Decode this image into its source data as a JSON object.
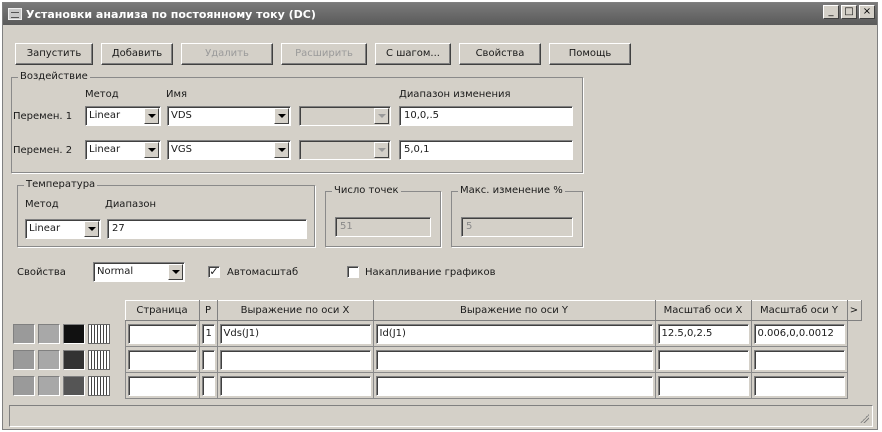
{
  "window": {
    "title": "Установки анализа по постоянному току (DC)",
    "controls": {
      "minimize": "_",
      "maximize": "□",
      "close": "×"
    }
  },
  "toolbar": {
    "run": "Запустить",
    "add": "Добавить",
    "delete": "Удалить",
    "expand": "Расширить",
    "step": "С шагом...",
    "properties": "Свойства",
    "help": "Помощь"
  },
  "sweep": {
    "group_label": "Воздействие",
    "header_method": "Метод",
    "header_name": "Имя",
    "header_range": "Диапазон изменения",
    "rows": [
      {
        "label": "Перемен. 1",
        "method": "Linear",
        "name": "VDS",
        "extra": "",
        "range": "10,0,.5"
      },
      {
        "label": "Перемен. 2",
        "method": "Linear",
        "name": "VGS",
        "extra": "",
        "range": "5,0,1"
      }
    ]
  },
  "temperature": {
    "group_label": "Температура",
    "method_label": "Метод",
    "range_label": "Диапазон",
    "method": "Linear",
    "range": "27"
  },
  "points": {
    "group_label": "Число точек",
    "value": "51"
  },
  "maxchange": {
    "group_label": "Макс. изменение %",
    "value": "5"
  },
  "options": {
    "properties_label": "Свойства",
    "properties_value": "Normal",
    "autoscale_label": "Автомасштаб",
    "autoscale_checked": true,
    "accumulate_label": "Накапливание графиков",
    "accumulate_checked": false
  },
  "grid": {
    "headers": {
      "page": "Страница",
      "p": "P",
      "xexpr": "Выражение по оси X",
      "yexpr": "Выражение по оси Y",
      "xscale": "Масштаб оси X",
      "yscale": "Масштаб оси Y",
      "more": ">"
    },
    "rows": [
      {
        "page": "",
        "p": "1",
        "xexpr": "Vds(J1)",
        "yexpr": "Id(J1)",
        "xscale": "12.5,0,2.5",
        "yscale": "0.006,0,0.0012"
      },
      {
        "page": "",
        "p": "",
        "xexpr": "",
        "yexpr": "",
        "xscale": "",
        "yscale": ""
      },
      {
        "page": "",
        "p": "",
        "xexpr": "",
        "yexpr": "",
        "xscale": "",
        "yscale": ""
      }
    ],
    "row_colors": [
      [
        "#9a9a9a",
        "#a8a8a8",
        "#111111"
      ],
      [
        "#9a9a9a",
        "#a8a8a8",
        "#333333"
      ],
      [
        "#9a9a9a",
        "#a8a8a8",
        "#555555"
      ]
    ]
  }
}
